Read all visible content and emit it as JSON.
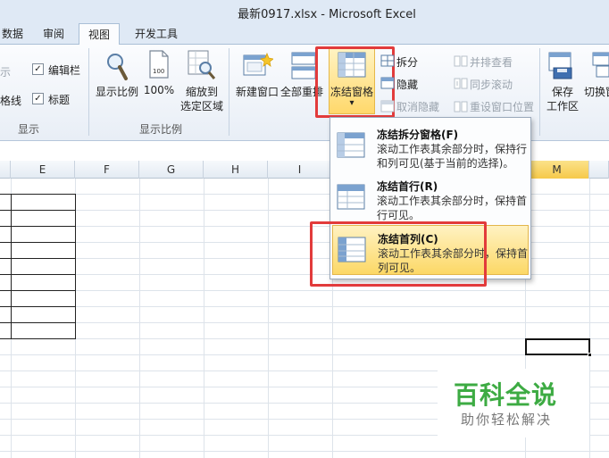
{
  "window": {
    "title": "最新0917.xlsx  -  Microsoft Excel"
  },
  "tabs": [
    {
      "label": "数据",
      "active": false
    },
    {
      "label": "审阅",
      "active": false
    },
    {
      "label": "视图",
      "active": true
    },
    {
      "label": "开发工具",
      "active": false
    }
  ],
  "ribbon": {
    "show_group": {
      "label": "显示",
      "ruler_label": "示",
      "formula_bar": {
        "label": "编辑栏",
        "checked": true
      },
      "gridlines_label": "格线",
      "headings": {
        "label": "标题",
        "checked": true
      }
    },
    "zoom_group": {
      "label": "显示比例",
      "zoom": "显示比例",
      "zoom100": "100%",
      "zoom_selection_line1": "缩放到",
      "zoom_selection_line2": "选定区域"
    },
    "window_group": {
      "new_window": "新建窗口",
      "arrange_all": "全部重排",
      "freeze_panes": "冻结窗格",
      "freeze_arrow": "▾",
      "split": "拆分",
      "hide": "隐藏",
      "unhide": "取消隐藏",
      "side_by_side": "并排查看",
      "sync_scroll": "同步滚动",
      "reset_position": "重设窗口位置",
      "save_workspace_line1": "保存",
      "save_workspace_line2": "工作区",
      "switch_windows": "切换窗"
    }
  },
  "sheet": {
    "columns": [
      "E",
      "F",
      "G",
      "H",
      "I",
      "M"
    ],
    "selected_column": "M"
  },
  "dropdown": {
    "items": [
      {
        "title": "冻结拆分窗格(F)",
        "desc": "滚动工作表其余部分时，保持行和列可见(基于当前的选择)。",
        "highlighted": false
      },
      {
        "title": "冻结首行(R)",
        "desc": "滚动工作表其余部分时，保持首行可见。",
        "highlighted": false
      },
      {
        "title": "冻结首列(C)",
        "desc": "滚动工作表其余部分时，保持首列可见。",
        "highlighted": true
      }
    ]
  },
  "watermark": {
    "title": "百科全说",
    "subtitle": "助你轻松解决"
  },
  "colors": {
    "accent_highlight": "#fcd866",
    "annotation_red": "#e23b3b",
    "watermark_green": "#3dab43"
  }
}
